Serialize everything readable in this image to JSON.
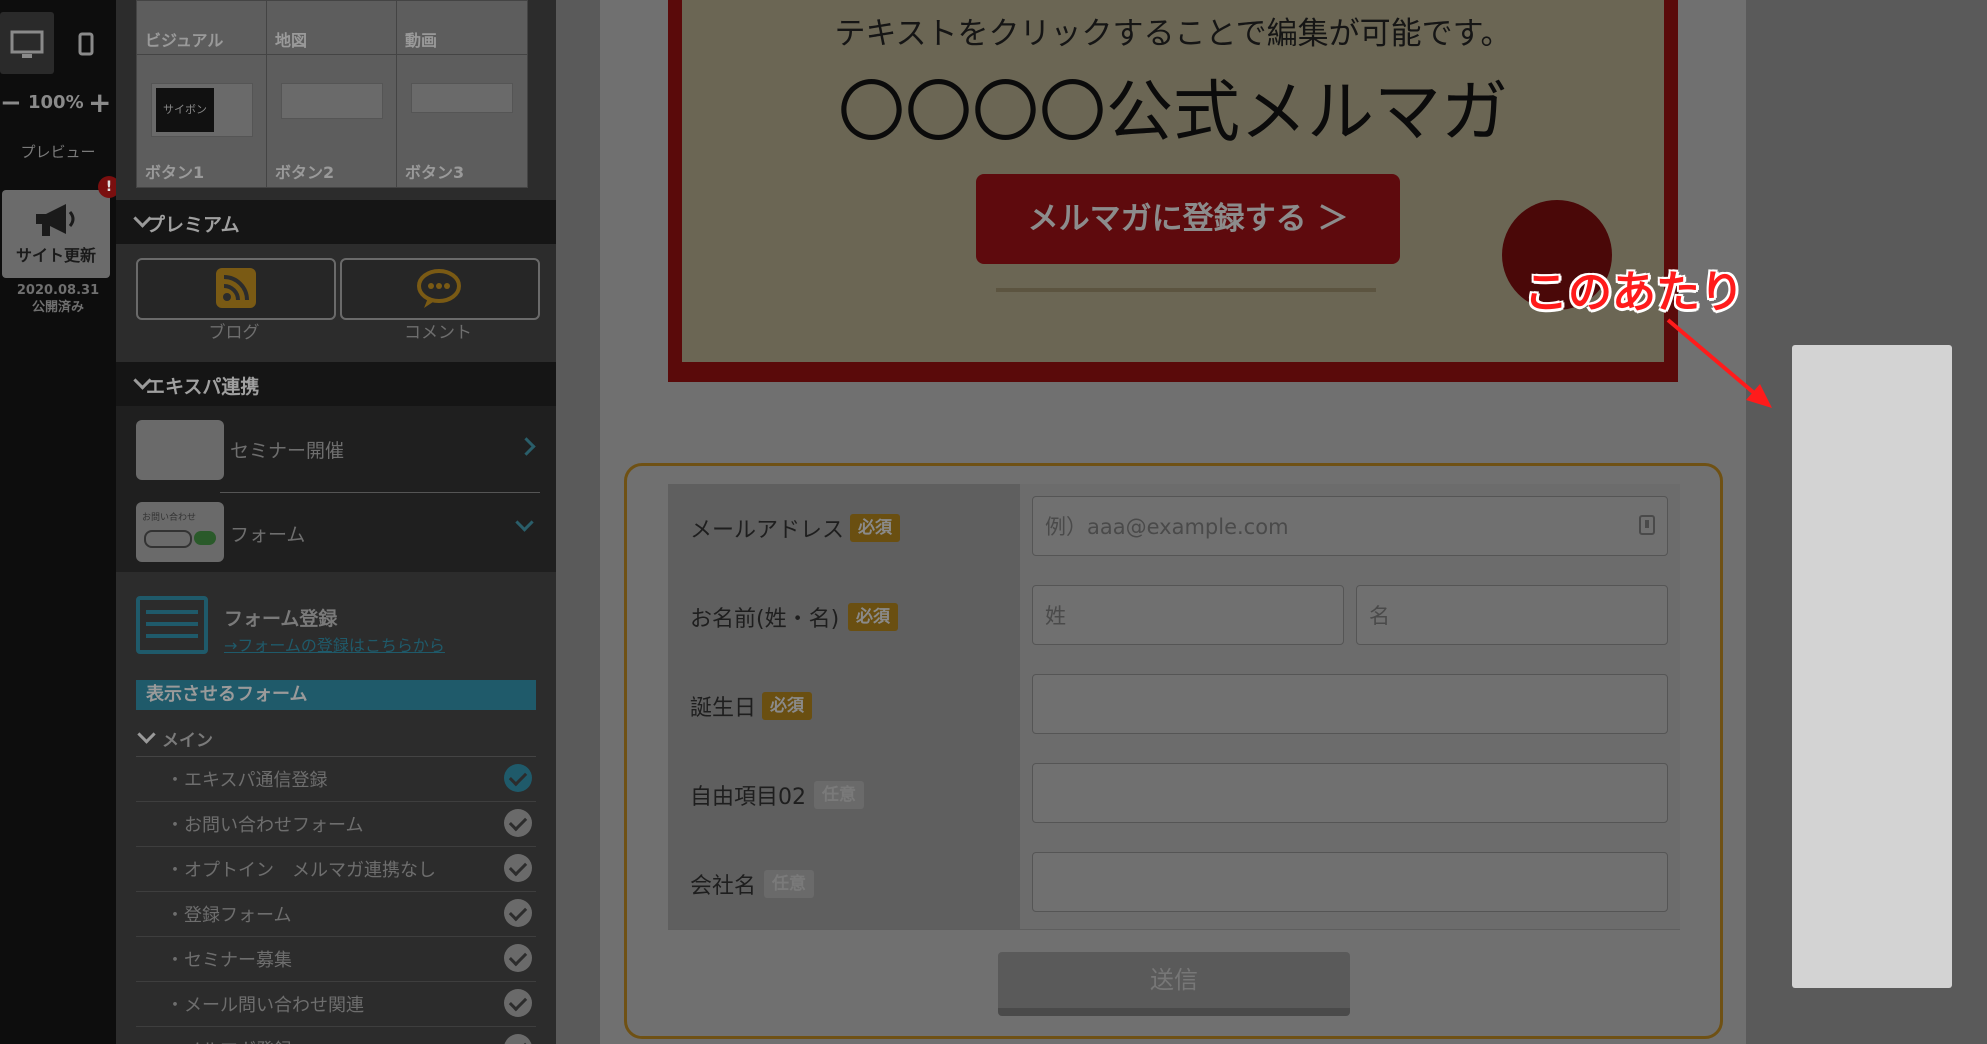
{
  "rail": {
    "zoom_level": "100%",
    "zoom_minus": "−",
    "zoom_plus": "+",
    "preview_label": "プレビュー",
    "site_update_label": "サイト更新",
    "badge": "!",
    "publish_date": "2020.08.31",
    "publish_status": "公開済み"
  },
  "parts": {
    "row1": [
      "ビジュアル",
      "地図",
      "動画"
    ],
    "row2": [
      "ボタン1",
      "ボタン2",
      "ボタン3"
    ],
    "thumb_text": "サイボン"
  },
  "premium": {
    "title": "プレミアム",
    "items": [
      "ブログ",
      "コメント"
    ]
  },
  "xserver": {
    "title": "エキスパ連携",
    "items": [
      "セミナー開催",
      "フォーム"
    ],
    "thumb_form_text": "お問い合わせ"
  },
  "form_register": {
    "title": "フォーム登録",
    "link": "→フォームの登録はこちらから",
    "display_bar": "表示させるフォーム",
    "group_title": "メイン",
    "list": [
      "・エキスパ通信登録",
      "・お問い合わせフォーム",
      "・オプトイン　メルマガ連携なし",
      "・登録フォーム",
      "・セミナー募集",
      "・メール問い合わせ関連",
      "・メルマガ登録"
    ]
  },
  "banner": {
    "subtitle": "テキストをクリックすることで編集が可能です。",
    "title": "〇〇〇〇公式メルマガ",
    "cta": "メルマガに登録する ＞"
  },
  "form": {
    "rows": [
      {
        "label": "メールアドレス",
        "tag": "必須",
        "placeholder": "例）aaa@example.com"
      },
      {
        "label": "お名前(姓・名)",
        "tag": "必須",
        "placeholder_last": "姓",
        "placeholder_first": "名"
      },
      {
        "label": "誕生日",
        "tag": "必須"
      },
      {
        "label": "自由項目02",
        "tag": "任意"
      },
      {
        "label": "会社名",
        "tag": "任意"
      }
    ],
    "submit": "送信"
  },
  "annotation": "このあたり",
  "colors": {
    "annotation": "#ff1b1b",
    "required": "#6a4f11",
    "frame": "#6f5114"
  }
}
